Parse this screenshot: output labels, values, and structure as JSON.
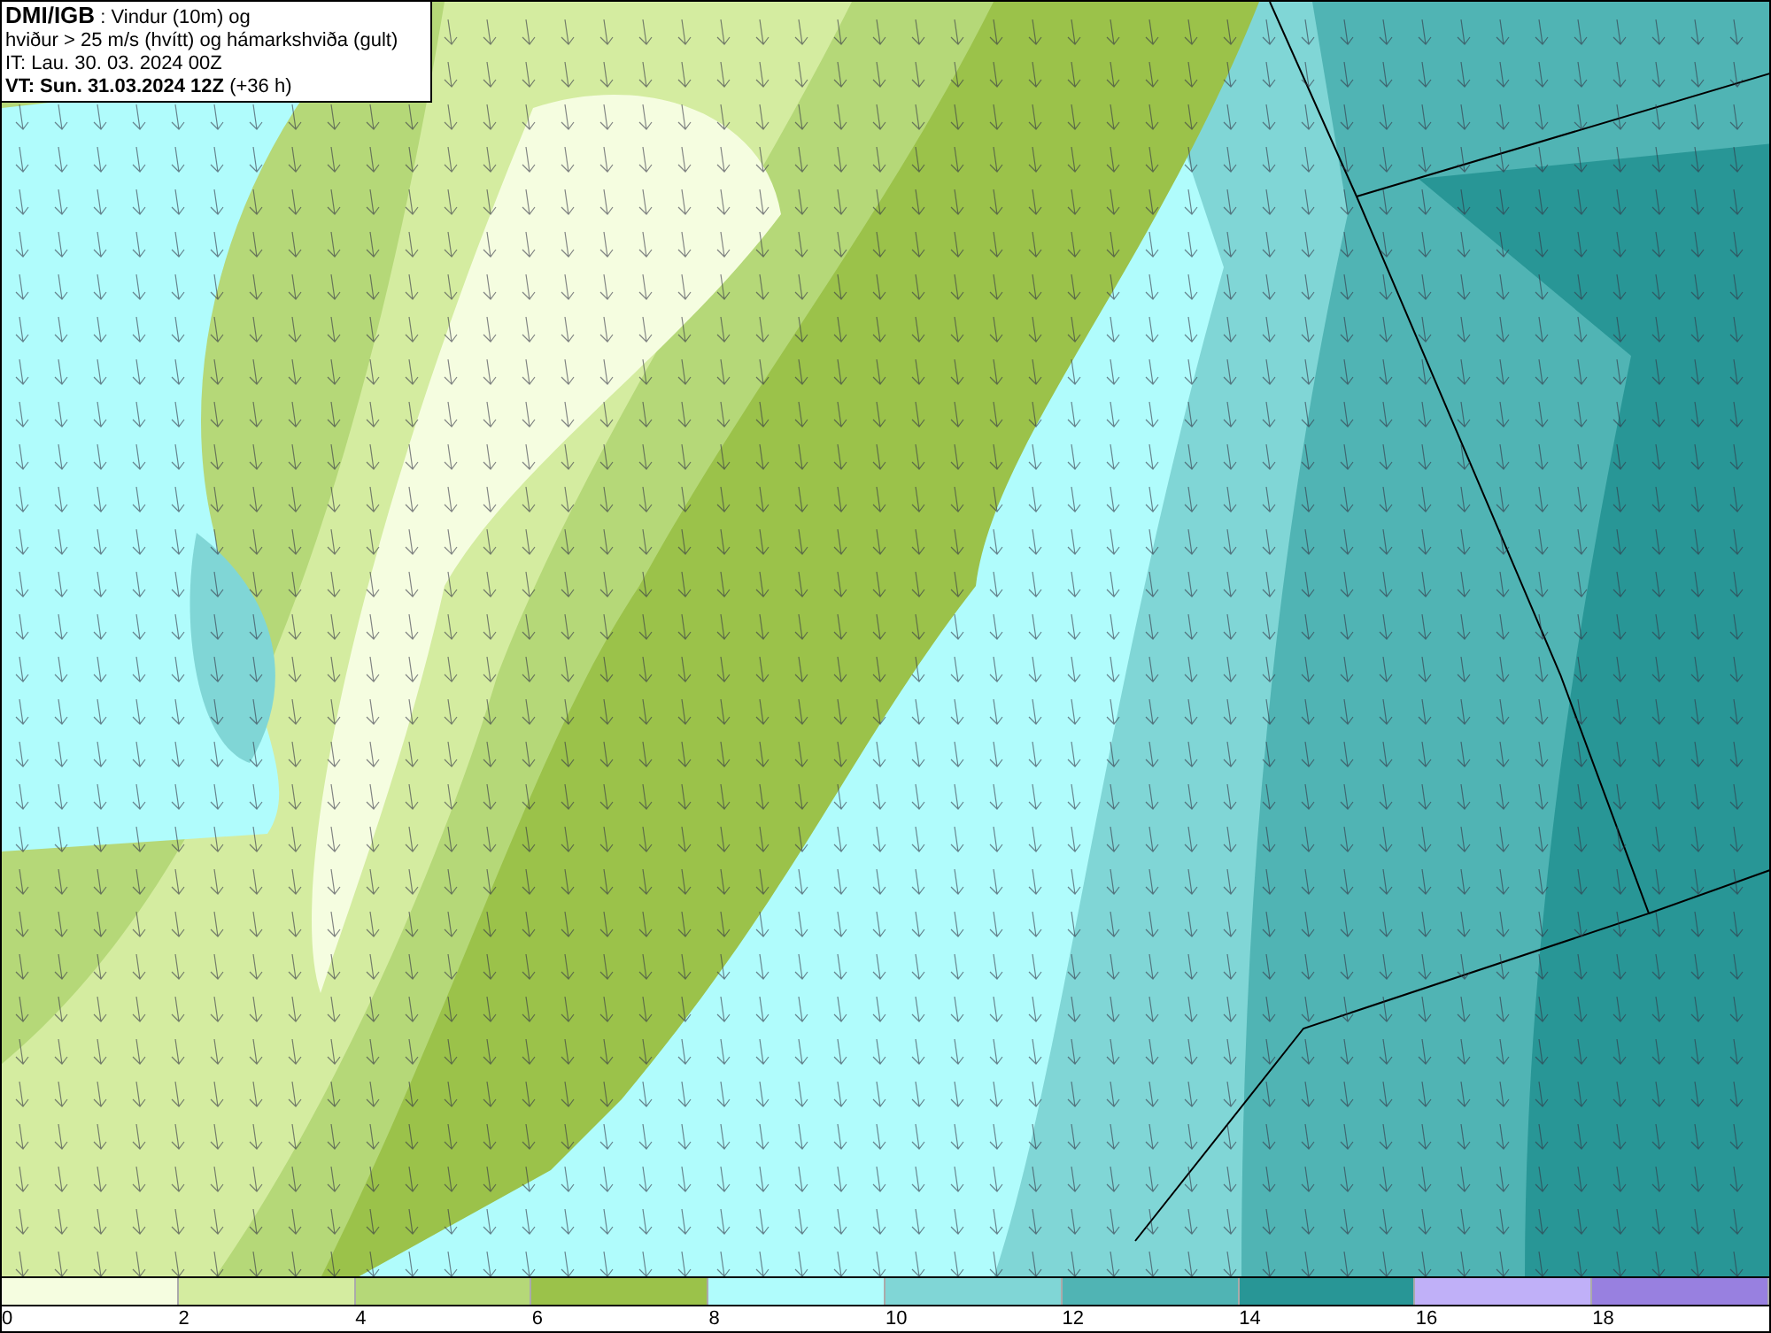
{
  "header": {
    "source": "DMI/IGB",
    "title_rest": " : Vindur (10m) og",
    "subtitle": "hviður > 25 m/s (hvítt) og hámarkshviða (gult)",
    "initial_time": "IT: Lau. 30. 03. 2024 00Z",
    "valid_time": "VT: Sun. 31.03.2024 12Z",
    "lead_time": " (+36 h)"
  },
  "legend": {
    "swatches": [
      {
        "color": "#f5fde0"
      },
      {
        "color": "#d4eca0"
      },
      {
        "color": "#b5d878"
      },
      {
        "color": "#9bc24a"
      },
      {
        "color": "#b0fcfc"
      },
      {
        "color": "#80d6d6"
      },
      {
        "color": "#50b4b4"
      },
      {
        "color": "#289696"
      },
      {
        "color": "#c0b0f8"
      },
      {
        "color": "#9880e0"
      }
    ],
    "labels": [
      "0",
      "2",
      "4",
      "6",
      "8",
      "10",
      "12",
      "14",
      "16",
      "18"
    ]
  }
}
